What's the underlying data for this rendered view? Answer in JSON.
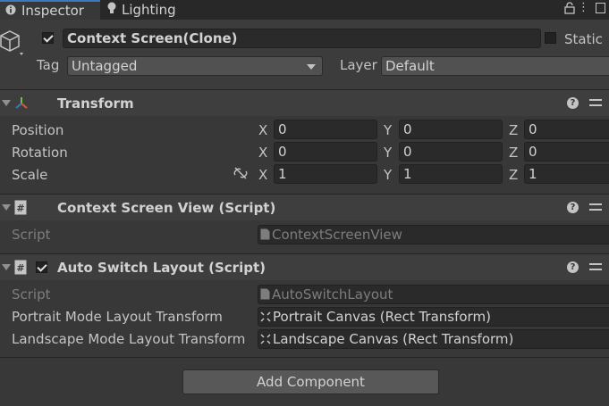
{
  "tabs": {
    "inspector": "Inspector",
    "lighting": "Lighting"
  },
  "gameobject": {
    "active": true,
    "name": "Context Screen(Clone)",
    "static_label": "Static",
    "static_checked": false,
    "tag_label": "Tag",
    "tag_value": "Untagged",
    "layer_label": "Layer",
    "layer_value": "Default"
  },
  "transform": {
    "title": "Transform",
    "rows": [
      {
        "label": "Position",
        "x": "0",
        "y": "0",
        "z": "0"
      },
      {
        "label": "Rotation",
        "x": "0",
        "y": "0",
        "z": "0"
      },
      {
        "label": "Scale",
        "x": "1",
        "y": "1",
        "z": "1"
      }
    ],
    "axis": {
      "x": "X",
      "y": "Y",
      "z": "Z"
    }
  },
  "context_screen_view": {
    "title": "Context Screen View (Script)",
    "script_label": "Script",
    "script_value": "ContextScreenView"
  },
  "auto_switch_layout": {
    "title": "Auto Switch Layout (Script)",
    "enabled": true,
    "script_label": "Script",
    "script_value": "AutoSwitchLayout",
    "portrait_label": "Portrait Mode Layout Transform",
    "portrait_value": "Portrait Canvas (Rect Transform)",
    "landscape_label": "Landscape Mode Layout Transform",
    "landscape_value": "Landscape Canvas (Rect Transform)"
  },
  "add_component": "Add Component",
  "colors": {
    "accent": "#3a79bb",
    "background": "#383838",
    "header_bg": "#3e3e3e"
  }
}
